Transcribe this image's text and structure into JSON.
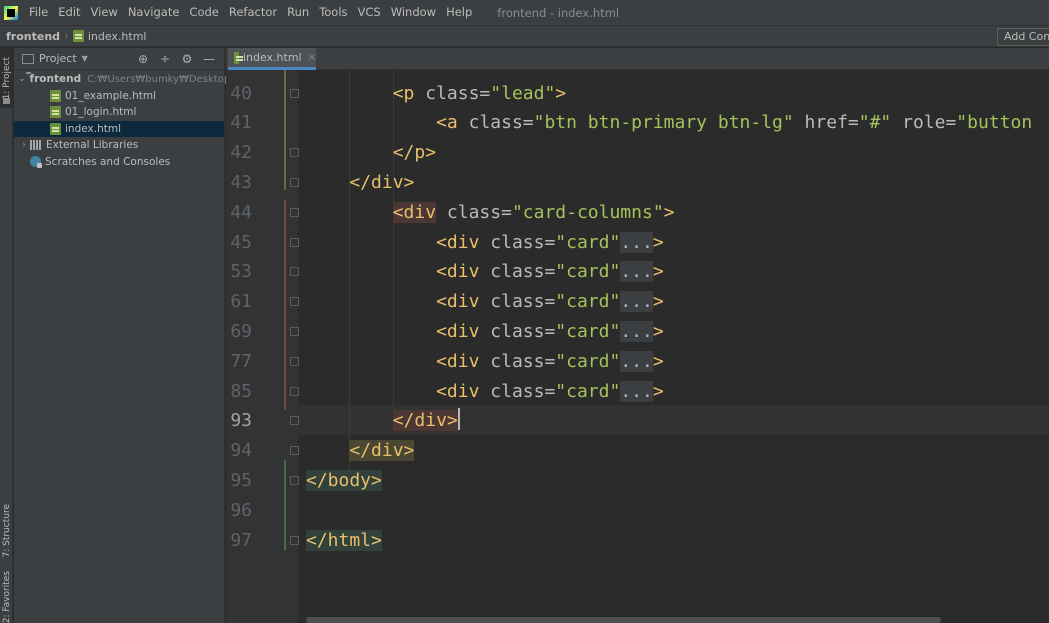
{
  "menu": {
    "items": [
      "File",
      "Edit",
      "View",
      "Navigate",
      "Code",
      "Refactor",
      "Run",
      "Tools",
      "VCS",
      "Window",
      "Help"
    ],
    "window_title": "frontend - index.html"
  },
  "navbar": {
    "root": "frontend",
    "file": "index.html",
    "add_config": "Add Configuration..."
  },
  "toolstrip": {
    "project_tab": "1: Project",
    "structure_tab": "7: Structure",
    "favorites_tab": "2: Favorites"
  },
  "project_panel": {
    "title": "Project",
    "root": {
      "name": "frontend",
      "path": "C:₩Users₩bumky₩Desktop₩"
    },
    "files": [
      "01_example.html",
      "01_login.html",
      "index.html"
    ],
    "selected_file": "index.html",
    "external_libraries": "External Libraries",
    "scratches": "Scratches and Consoles"
  },
  "editor": {
    "tab_label": "index.html",
    "tab_close": "×",
    "current_line": "93",
    "lines": [
      {
        "num": "40",
        "parts": [
          "<p",
          " class=",
          "\"lead\"",
          ">"
        ]
      },
      {
        "num": "41",
        "parts": [
          "<a",
          " class=",
          "\"btn btn-primary btn-lg\"",
          " href=",
          "\"#\"",
          " role=",
          "\"button"
        ]
      },
      {
        "num": "42",
        "parts": [
          "</p>"
        ]
      },
      {
        "num": "43",
        "parts": [
          "</div>"
        ]
      },
      {
        "num": "44",
        "parts": [
          "<div",
          " class=",
          "\"card-columns\"",
          ">"
        ]
      },
      {
        "num": "45",
        "parts": [
          "<div",
          " class=",
          "\"card\"",
          "...",
          ">"
        ]
      },
      {
        "num": "53",
        "parts": [
          "<div",
          " class=",
          "\"card\"",
          "...",
          ">"
        ]
      },
      {
        "num": "61",
        "parts": [
          "<div",
          " class=",
          "\"card\"",
          "...",
          ">"
        ]
      },
      {
        "num": "69",
        "parts": [
          "<div",
          " class=",
          "\"card\"",
          "...",
          ">"
        ]
      },
      {
        "num": "77",
        "parts": [
          "<div",
          " class=",
          "\"card\"",
          "...",
          ">"
        ]
      },
      {
        "num": "85",
        "parts": [
          "<div",
          " class=",
          "\"card\"",
          "...",
          ">"
        ]
      },
      {
        "num": "93",
        "parts": [
          "</div",
          ">"
        ]
      },
      {
        "num": "94",
        "parts": [
          "</div>"
        ]
      },
      {
        "num": "95",
        "parts": [
          "</body>"
        ]
      },
      {
        "num": "96",
        "parts": []
      },
      {
        "num": "97",
        "parts": [
          "</html>"
        ]
      }
    ]
  },
  "colors": {
    "tag": "#e8bf6a",
    "attribute": "#bababa",
    "string": "#a5c25c",
    "selection": "#0d293e",
    "tab_accent": "#4a88c7"
  }
}
